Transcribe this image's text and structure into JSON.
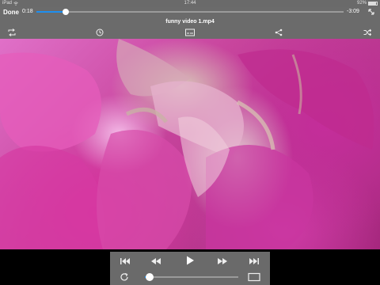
{
  "status_bar": {
    "device": "iPad",
    "time": "17:44",
    "battery_text": "92%",
    "battery_level": 0.92
  },
  "top_bar": {
    "done_label": "Done",
    "time_elapsed": "0:18",
    "time_remaining": "-3:09",
    "progress": 0.095,
    "title": "funny video 1.mp4",
    "icons": [
      "repeat-icon",
      "sleep-timer-icon",
      "subtitles-icon",
      "share-icon",
      "shuffle-icon"
    ]
  },
  "bottom_bar": {
    "buttons": [
      "skip-previous-icon",
      "rewind-icon",
      "play-icon",
      "fast-forward-icon",
      "skip-next-icon"
    ],
    "speed_level": 0.05
  },
  "colors": {
    "accent": "#1e8ff0",
    "bar_background": "#6b6b6b"
  }
}
